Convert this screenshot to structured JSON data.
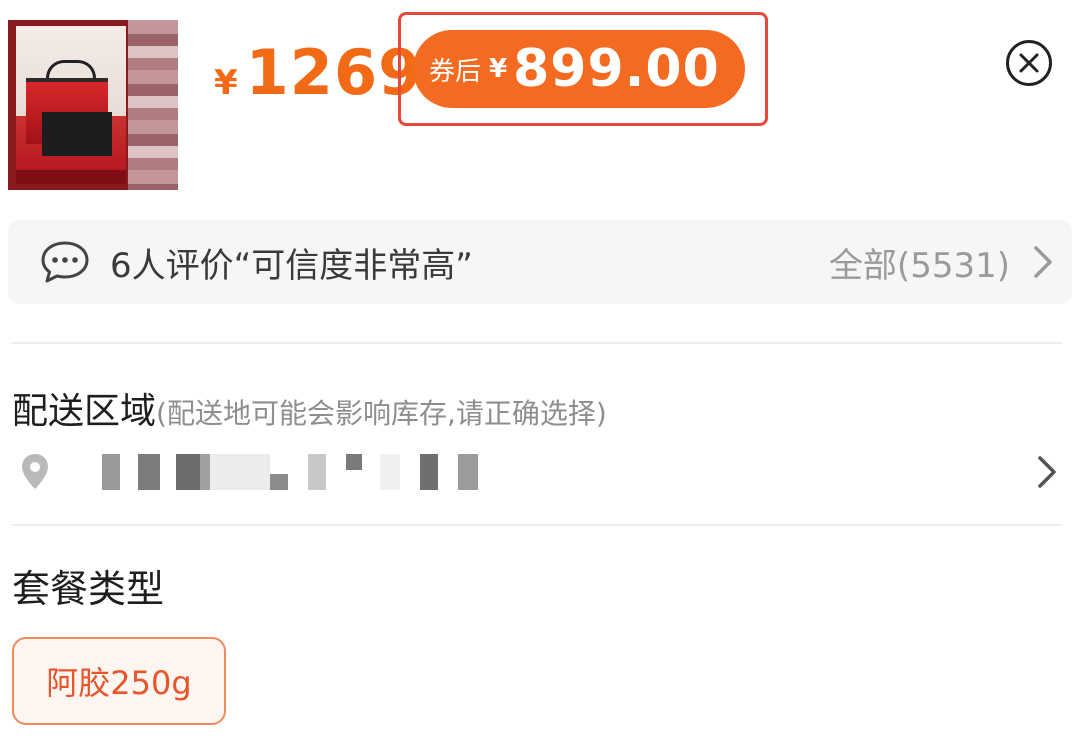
{
  "product": {
    "image_alt": "礼盒套装商品图"
  },
  "price": {
    "currency_symbol": "¥",
    "original": "1269",
    "coupon_label": "券后",
    "coupon_currency": "¥",
    "after_coupon": "899.00",
    "highlight_color": "#e8473a",
    "accent_color": "#f36a20"
  },
  "reviews": {
    "summary": "6人评价“可信度非常高”",
    "all_label": "全部(5531)"
  },
  "delivery": {
    "title": "配送区域",
    "hint": "(配送地可能会影响库存,请正确选择)",
    "address_blurred": true
  },
  "package": {
    "title": "套餐类型",
    "options": [
      {
        "label": "阿胶250g",
        "selected": true
      }
    ]
  },
  "icons": {
    "close": "close-circle-icon",
    "chat": "chat-bubble-icon",
    "chevron": "chevron-right-icon",
    "location": "location-pin-icon"
  }
}
